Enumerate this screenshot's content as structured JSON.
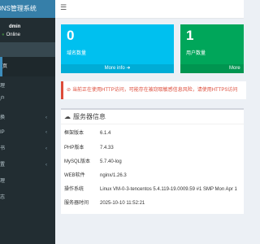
{
  "app": {
    "brand": "DNS管理系统"
  },
  "user": {
    "name": "dmin",
    "status": "Online"
  },
  "sidebar": {
    "items": [
      {
        "label": "页",
        "active": true
      },
      {
        "label": "理"
      },
      {
        "label": "户"
      },
      {
        "label": "换",
        "chevron": "‹"
      },
      {
        "label": "IP",
        "chevron": "‹"
      },
      {
        "label": "书",
        "chevron": "‹"
      },
      {
        "label": "置",
        "chevron": "‹"
      },
      {
        "label": "理"
      },
      {
        "label": "志"
      }
    ]
  },
  "header": {
    "menu_icon": "☰"
  },
  "stats": {
    "domains": {
      "value": "0",
      "label": "域名数量",
      "more": "More info ➜"
    },
    "users": {
      "value": "1",
      "label": "用户数量",
      "more": "More info"
    }
  },
  "alert": {
    "text": "当前正在使用HTTP访问，可能存在被窃取敏感信息风险，请使用HTTPS访问"
  },
  "server_info": {
    "title": "服务器信息",
    "rows": [
      {
        "key": "框架版本",
        "value": "6.1.4"
      },
      {
        "key": "PHP版本",
        "value": "7.4.33"
      },
      {
        "key": "MySQL版本",
        "value": "5.7.40-log"
      },
      {
        "key": "WEB软件",
        "value": "nginx/1.26.3"
      },
      {
        "key": "操作系统",
        "value": "Linux VM-0-3-tencentos 5.4.119-19.0009.59 #1 SMP Mon Apr 1"
      },
      {
        "key": "服务器时间",
        "value": "2025-10-10 11:52:21"
      }
    ]
  }
}
